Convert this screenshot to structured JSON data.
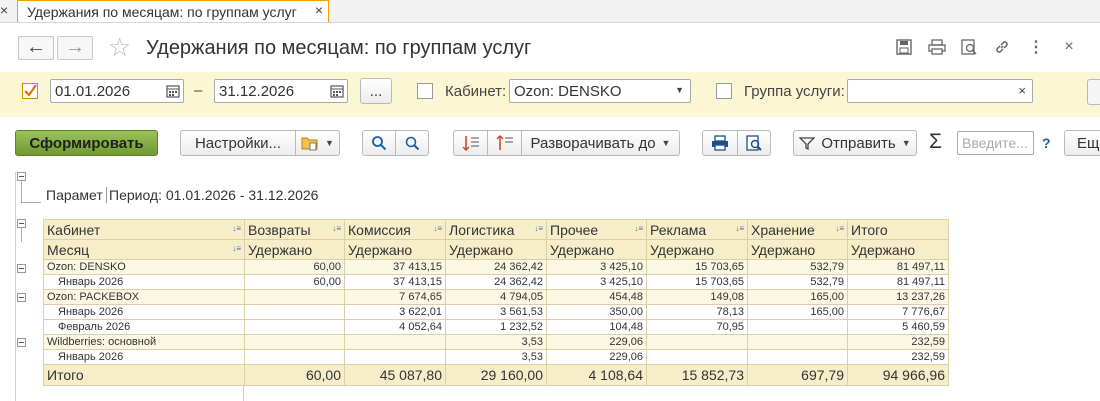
{
  "tab": {
    "label": "Удержания по месяцам: по группам услуг"
  },
  "window": {
    "title": "Удержания по месяцам: по группам услуг"
  },
  "filters": {
    "date_from": "01.01.2026",
    "dash": "–",
    "date_to": "31.12.2026",
    "more_label": "...",
    "cabinet_label": "Кабинет:",
    "cabinet_value": "Ozon: DENSKO",
    "group_label": "Группа услуги:",
    "group_value": ""
  },
  "toolbar": {
    "generate": "Сформировать",
    "settings": "Настройки...",
    "expand": "Разворачивать до",
    "send": "Отправить",
    "sigma": "Σ",
    "search_placeholder": "Введите...",
    "help": "?",
    "more": "Еще"
  },
  "report": {
    "params_label": "Парамет",
    "period_text": "Период: 01.01.2026 - 31.12.2026",
    "header_row1": [
      "Кабинет",
      "Возвраты",
      "Комиссия",
      "Логистика",
      "Прочее",
      "Реклама",
      "Хранение",
      "Итого"
    ],
    "header_row2": [
      "Месяц",
      "Удержано",
      "Удержано",
      "Удержано",
      "Удержано",
      "Удержано",
      "Удержано",
      "Удержано"
    ],
    "rows": [
      {
        "name": "Ozon: DENSKO",
        "group": true,
        "values": [
          "60,00",
          "37 413,15",
          "24 362,42",
          "3 425,10",
          "15 703,65",
          "532,79",
          "81 497,11"
        ]
      },
      {
        "name": "Январь 2026",
        "group": false,
        "values": [
          "60,00",
          "37 413,15",
          "24 362,42",
          "3 425,10",
          "15 703,65",
          "532,79",
          "81 497,11"
        ]
      },
      {
        "name": "Ozon: PACKEBOX",
        "group": true,
        "values": [
          "",
          "7 674,65",
          "4 794,05",
          "454,48",
          "149,08",
          "165,00",
          "13 237,26"
        ]
      },
      {
        "name": "Январь 2026",
        "group": false,
        "values": [
          "",
          "3 622,01",
          "3 561,53",
          "350,00",
          "78,13",
          "165,00",
          "7 776,67"
        ]
      },
      {
        "name": "Февраль 2026",
        "group": false,
        "values": [
          "",
          "4 052,64",
          "1 232,52",
          "104,48",
          "70,95",
          "",
          "5 460,59"
        ]
      },
      {
        "name": "Wildberries: основной",
        "group": true,
        "values": [
          "",
          "",
          "3,53",
          "229,06",
          "",
          "",
          "232,59"
        ]
      },
      {
        "name": "Январь 2026",
        "group": false,
        "values": [
          "",
          "",
          "3,53",
          "229,06",
          "",
          "",
          "232,59"
        ]
      }
    ],
    "total": {
      "name": "Итого",
      "values": [
        "60,00",
        "45 087,80",
        "29 160,00",
        "4 108,64",
        "15 852,73",
        "697,79",
        "94 966,96"
      ]
    }
  }
}
